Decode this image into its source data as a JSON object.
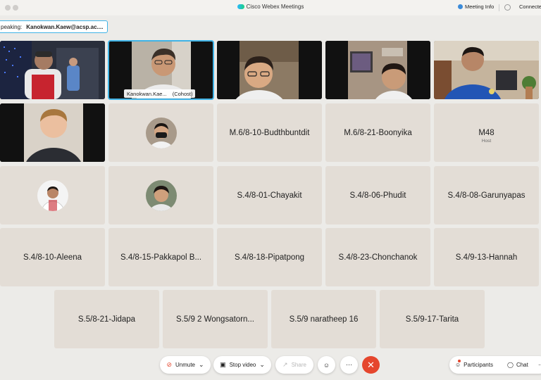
{
  "window": {
    "title": "Cisco Webex Meetings",
    "meeting_info": "Meeting Info",
    "connection": "Connected"
  },
  "speaking": {
    "label": "peaking:",
    "name": "Kanokwan.Kaew@acsp.ac...."
  },
  "video_tiles": [
    {
      "name": ""
    },
    {
      "name": "Kanokwan.Kae...",
      "role": "(Cohost)"
    },
    {
      "name": ""
    },
    {
      "name": ""
    },
    {
      "name": ""
    },
    {
      "name": ""
    }
  ],
  "avatar_tiles": [
    {
      "name": ""
    },
    {
      "name": ""
    },
    {
      "name": ""
    }
  ],
  "name_tiles": [
    {
      "name": "M.6/8-10-Budthbuntdit"
    },
    {
      "name": "M.6/8-21-Boonyika"
    },
    {
      "name": "M48",
      "role": "Host"
    },
    {
      "name": "S.4/8-01-Chayakit"
    },
    {
      "name": "S.4/8-06-Phudit"
    },
    {
      "name": "S.4/8-08-Garunyapas"
    },
    {
      "name": "S.4/8-10-Aleena"
    },
    {
      "name": "S.4/8-15-Pakkapol B..."
    },
    {
      "name": "S.4/8-18-Pipatpong"
    },
    {
      "name": "S.4/8-23-Chonchanok"
    },
    {
      "name": "S.4/9-13-Hannah"
    },
    {
      "name": "S.5/8-21-Jidapa"
    },
    {
      "name": "S.5/9 2 Wongsatorn..."
    },
    {
      "name": "S.5/9 naratheep 16"
    },
    {
      "name": "S.5/9-17-Tarita"
    }
  ],
  "controls": {
    "unmute": "Unmute",
    "stop_video": "Stop video",
    "share": "Share",
    "participants": "Participants",
    "chat": "Chat"
  },
  "colors": {
    "accent": "#3fb3e6",
    "end_call": "#e5462d",
    "tile_bg": "#e3ddd6"
  }
}
